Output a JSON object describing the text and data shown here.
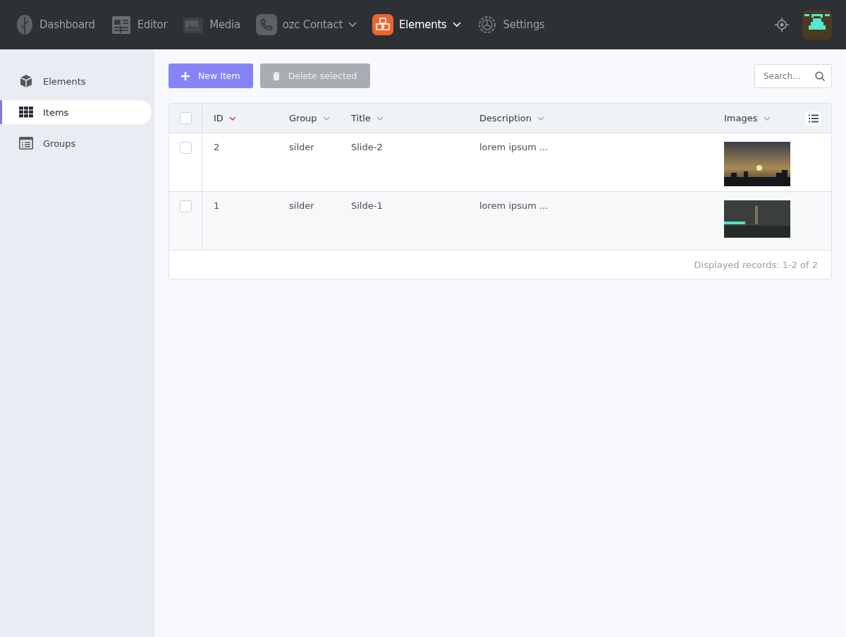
{
  "topnav": {
    "items": [
      {
        "label": "Dashboard",
        "selected": false,
        "kind": "link"
      },
      {
        "label": "Editor",
        "selected": false,
        "kind": "link"
      },
      {
        "label": "Media",
        "selected": false,
        "kind": "link"
      },
      {
        "label": "ozc Contact",
        "selected": false,
        "kind": "dropdown"
      },
      {
        "label": "Elements",
        "selected": true,
        "kind": "dropdown"
      },
      {
        "label": "Settings",
        "selected": false,
        "kind": "link"
      }
    ]
  },
  "sidebar": {
    "items": [
      {
        "label": "Elements",
        "selected": false
      },
      {
        "label": "Items",
        "selected": true
      },
      {
        "label": "Groups",
        "selected": false
      }
    ]
  },
  "toolbar": {
    "new_button": {
      "label": "New Item"
    },
    "delete_button": {
      "label": "Delete selected",
      "disabled": true
    },
    "search": {
      "placeholder": "Search..."
    }
  },
  "table": {
    "select_all": {
      "checked": false
    },
    "columns": [
      {
        "label": "ID",
        "sorted": true
      },
      {
        "label": "Group",
        "sorted": false
      },
      {
        "label": "Title",
        "sorted": false
      },
      {
        "label": "Description",
        "sorted": false
      },
      {
        "label": "Images",
        "sorted": false
      }
    ],
    "rows": [
      {
        "checked": false,
        "cells": [
          "2",
          "silder",
          "Slide-2",
          "lorem ipsum ..."
        ]
      },
      {
        "checked": false,
        "cells": [
          "1",
          "silder",
          "Silde-1",
          "lorem ipsum ..."
        ]
      }
    ],
    "footer": "Displayed records: 1-2 of 2"
  }
}
